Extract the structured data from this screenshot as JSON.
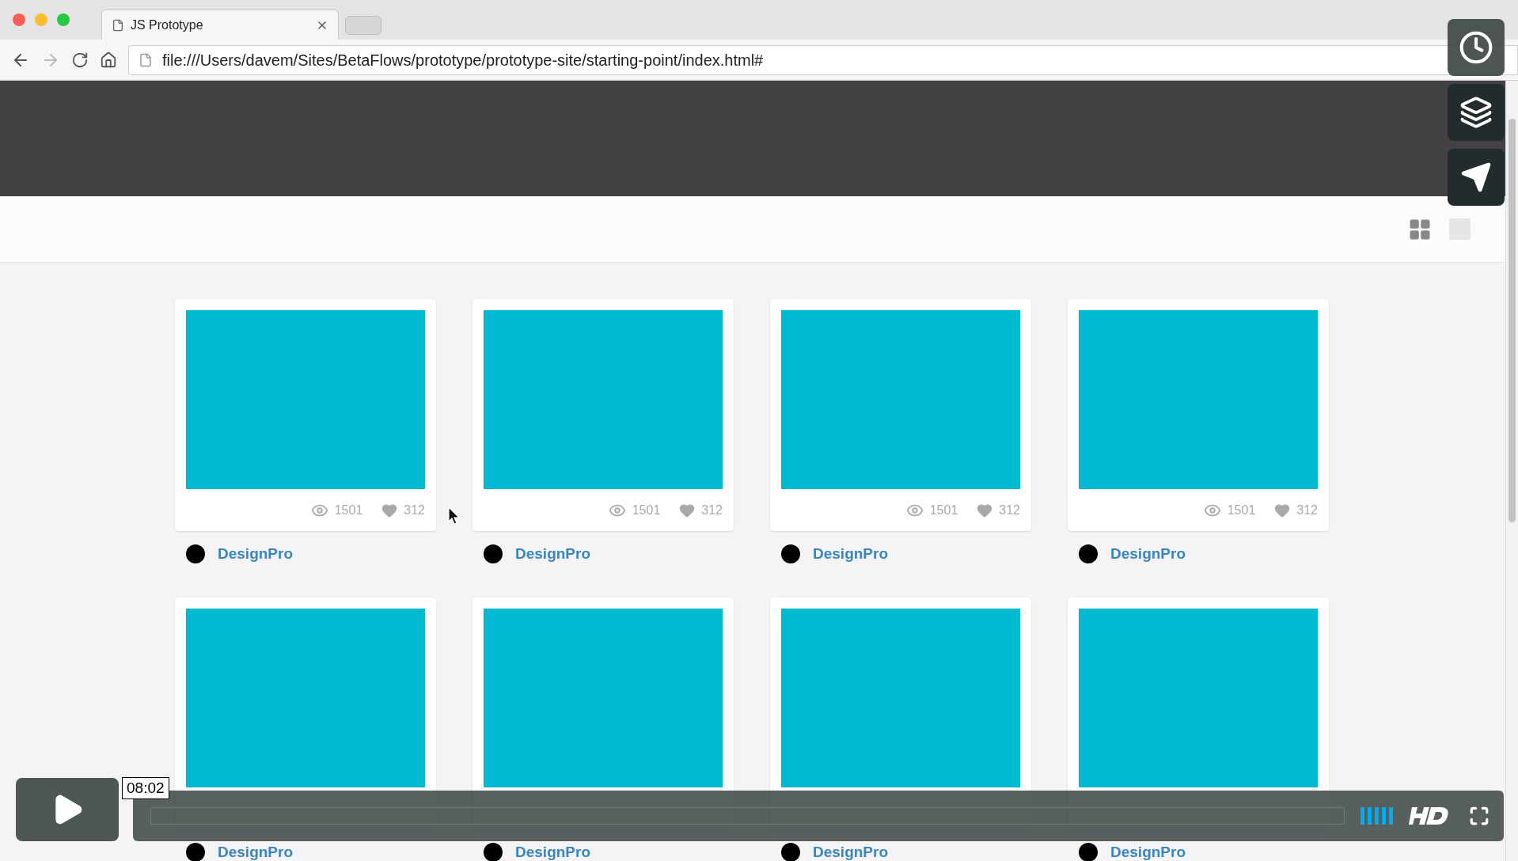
{
  "browser": {
    "tab_title": "JS Prototype",
    "url": "file:///Users/davem/Sites/BetaFlows/prototype/prototype-site/starting-point/index.html#"
  },
  "cards": [
    {
      "views": "1501",
      "likes": "312",
      "author": "DesignPro"
    },
    {
      "views": "1501",
      "likes": "312",
      "author": "DesignPro"
    },
    {
      "views": "1501",
      "likes": "312",
      "author": "DesignPro"
    },
    {
      "views": "1501",
      "likes": "312",
      "author": "DesignPro"
    },
    {
      "author": "DesignPro"
    },
    {
      "author": "DesignPro"
    },
    {
      "author": "DesignPro"
    },
    {
      "author": "DesignPro"
    }
  ],
  "player": {
    "time": "08:02"
  }
}
